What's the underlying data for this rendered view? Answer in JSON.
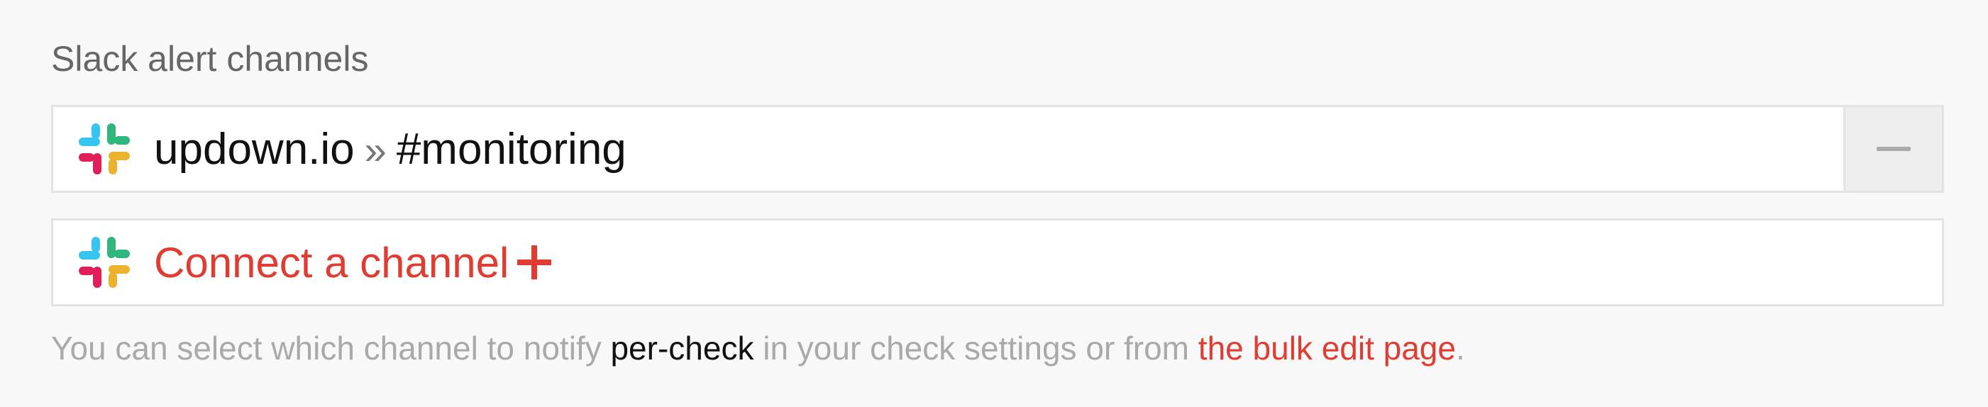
{
  "section": {
    "title": "Slack alert channels"
  },
  "channel": {
    "workspace": "updown.io",
    "separator": "»",
    "name": "#monitoring",
    "icon": "slack-icon"
  },
  "remove": {
    "icon": "minus-icon"
  },
  "connect": {
    "label": "Connect a channel",
    "icon": "plus-icon"
  },
  "help": {
    "part1": "You can select which channel to notify ",
    "emphasis": "per-check",
    "part2": " in your check settings or from ",
    "link": "the bulk edit page",
    "part3": "."
  },
  "colors": {
    "accent": "#e03c31",
    "slack_blue": "#36c5f0",
    "slack_green": "#2eb67d",
    "slack_red": "#e01e5a",
    "slack_yellow": "#ecb22e"
  }
}
